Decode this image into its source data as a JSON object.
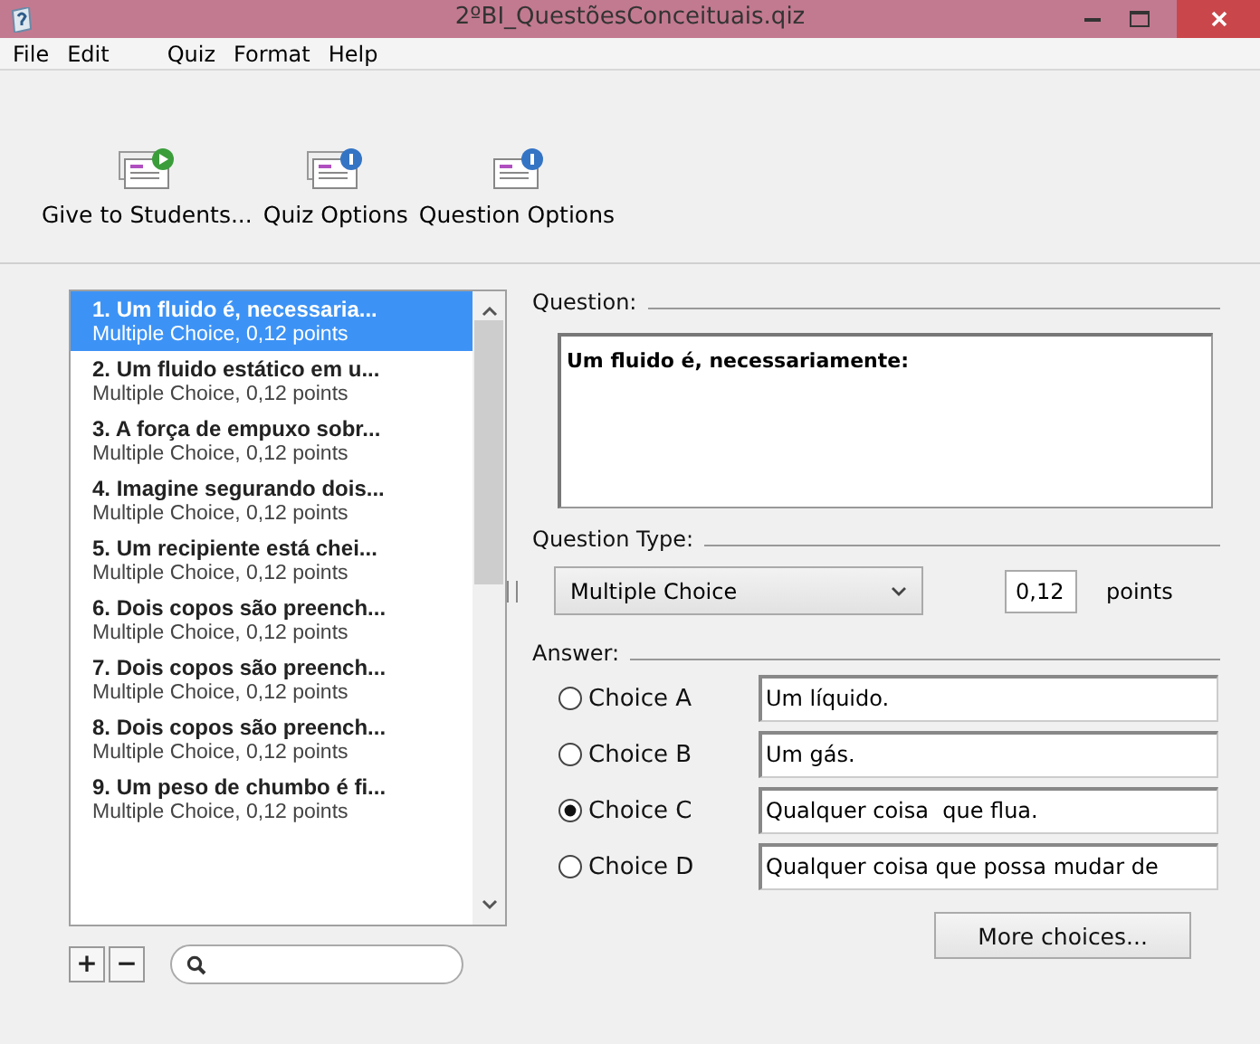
{
  "window": {
    "title": "2ºBI_QuestõesConceituais.qiz"
  },
  "menu": [
    "File",
    "Edit",
    "Quiz",
    "Format",
    "Help"
  ],
  "toolbar": [
    {
      "label": "Give to Students...",
      "kind": "play"
    },
    {
      "label": "Quiz Options",
      "kind": "info-stack"
    },
    {
      "label": "Question Options",
      "kind": "info-single"
    }
  ],
  "questions": [
    {
      "title": "1. Um fluido é, necessaria...",
      "detail": "Multiple Choice, 0,12 points",
      "selected": true
    },
    {
      "title": "2. Um fluido estático em u...",
      "detail": "Multiple Choice, 0,12 points",
      "selected": false
    },
    {
      "title": "3. A força de empuxo sobr...",
      "detail": "Multiple Choice, 0,12 points",
      "selected": false
    },
    {
      "title": "4. Imagine segurando dois...",
      "detail": "Multiple Choice, 0,12 points",
      "selected": false
    },
    {
      "title": "5. Um recipiente está chei...",
      "detail": "Multiple Choice, 0,12 points",
      "selected": false
    },
    {
      "title": "6. Dois copos são preench...",
      "detail": "Multiple Choice, 0,12 points",
      "selected": false
    },
    {
      "title": "7. Dois copos são preench...",
      "detail": "Multiple Choice, 0,12 points",
      "selected": false
    },
    {
      "title": "8. Dois copos são preench...",
      "detail": "Multiple Choice, 0,12 points",
      "selected": false
    },
    {
      "title": "9. Um peso de chumbo é fi...",
      "detail": "Multiple Choice, 0,12 points",
      "selected": false
    }
  ],
  "list_buttons": [
    "+",
    "−"
  ],
  "editor": {
    "question_label": "Question:",
    "question_text": "Um fluido é, necessariamente:",
    "type_label": "Question Type:",
    "type_value": "Multiple Choice",
    "points_value": "0,12",
    "points_label": "points",
    "answer_label": "Answer:",
    "choices": [
      {
        "label": "Choice A",
        "text": "Um líquido.",
        "selected": false
      },
      {
        "label": "Choice B",
        "text": "Um gás.",
        "selected": false
      },
      {
        "label": "Choice C",
        "text": "Qualquer coisa  que flua.",
        "selected": true
      },
      {
        "label": "Choice D",
        "text": "Qualquer coisa que possa mudar de",
        "selected": false
      }
    ],
    "more_button": "More choices..."
  }
}
